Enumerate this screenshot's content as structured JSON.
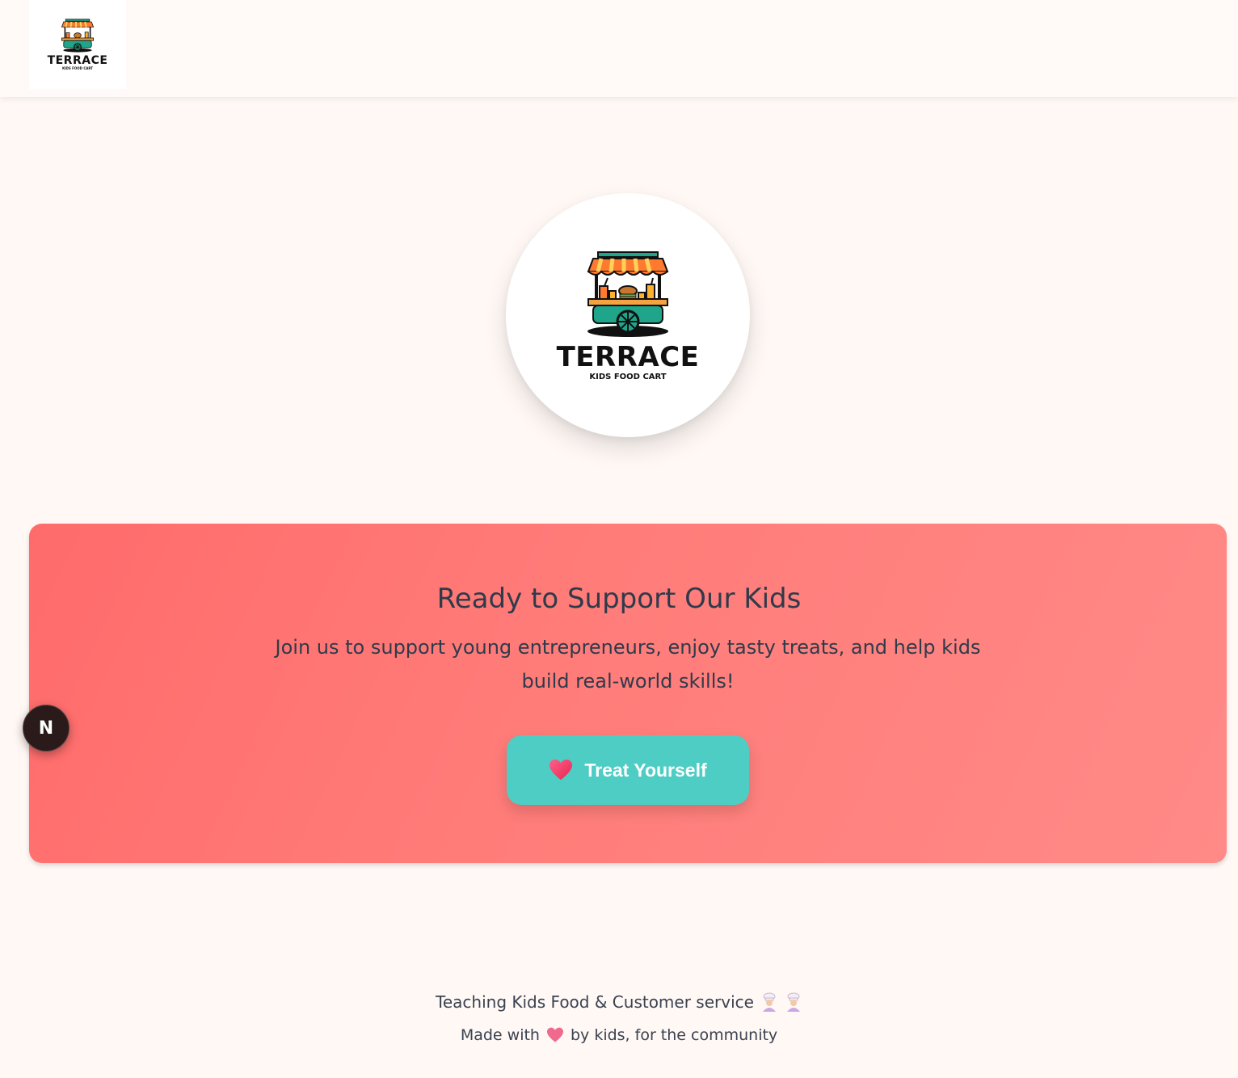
{
  "brand": {
    "name": "TERRACE",
    "tagline": "KIDS FOOD CART"
  },
  "cta": {
    "title": "Ready to Support Our Kids",
    "subtitle": "Join us to support young entrepreneurs, enjoy tasty treats, and help kids build real-world skills!",
    "button_label": "Treat Yourself"
  },
  "badge": {
    "letter": "N"
  },
  "footer": {
    "line1": "Teaching Kids Food & Customer service",
    "line2_prefix": "Made with",
    "line2_suffix": "by kids, for the community"
  },
  "colors": {
    "background": "#fff8f5",
    "cta_start": "#ff6b6b",
    "cta_end": "#ff8a87",
    "button": "#4ecdc4",
    "text": "#2f3a4a"
  },
  "icons": {
    "header_logo": "food-cart-logo",
    "hero_logo": "food-cart-logo",
    "button_icon": "heart-icon",
    "footer_icons": [
      "chef-icon",
      "chef-icon"
    ],
    "footer_heart": "heart-icon"
  }
}
